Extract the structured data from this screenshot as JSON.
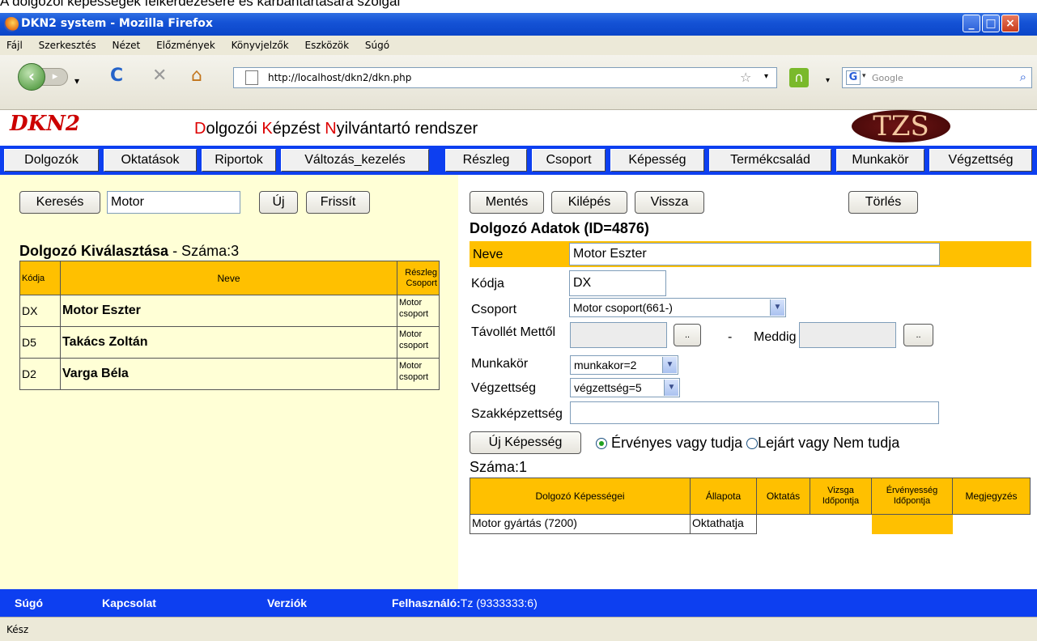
{
  "caption": "A dolgozói képességek felkérdezésére és karbantartására szolgál",
  "window": {
    "title": "DKN2 system - Mozilla Firefox"
  },
  "menu": [
    "Fájl",
    "Szerkesztés",
    "Nézet",
    "Előzmények",
    "Könyvjelzők",
    "Eszközök",
    "Súgó"
  ],
  "browser": {
    "url": "http://localhost/dkn2/dkn.php",
    "search_placeholder": "Google"
  },
  "app": {
    "logo": "DKN2",
    "title_parts": [
      {
        "t": "D",
        "red": true
      },
      {
        "t": "olgozói ",
        "red": false
      },
      {
        "t": "K",
        "red": true
      },
      {
        "t": "épzést ",
        "red": false
      },
      {
        "t": "N",
        "red": true
      },
      {
        "t": "yilvántartó rendszer",
        "red": false
      }
    ],
    "brand_logo": "TZS"
  },
  "tabs_left": [
    "Dolgozók",
    "Oktatások",
    "Riportok",
    "Változás_kezelés"
  ],
  "tabs_right": [
    "Részleg",
    "Csoport",
    "Képesség",
    "Termékcsalád",
    "Munkakör",
    "Végzettség"
  ],
  "left": {
    "search_button": "Keresés",
    "search_value": "Motor",
    "new_button": "Új",
    "refresh_button": "Frissít",
    "list_title": "Dolgozó  Kiválasztása",
    "list_count": " - Száma:3",
    "table_headers": {
      "code": "Kódja",
      "name": "Neve",
      "dept_line1": "Részleg",
      "dept_line2": "Csoport"
    },
    "rows": [
      {
        "code": "DX",
        "name": "Motor Eszter",
        "dept1": "Motor",
        "dept2": "csoport"
      },
      {
        "code": "D5",
        "name": "Takács Zoltán",
        "dept1": "Motor",
        "dept2": "csoport"
      },
      {
        "code": "D2",
        "name": "Varga Béla",
        "dept1": "Motor",
        "dept2": "csoport"
      }
    ]
  },
  "right": {
    "buttons": {
      "save": "Mentés",
      "exit": "Kilépés",
      "back": "Vissza",
      "delete": "Törlés"
    },
    "title": "Dolgozó Adatok (ID=4876)",
    "labels": {
      "name": "Neve",
      "code": "Kódja",
      "group": "Csoport",
      "absence_from": "Távollét Mettől",
      "absence_dash": "-",
      "absence_to": "Meddig",
      "job": "Munkakör",
      "education": "Végzettség",
      "qualification": "Szakképzettség"
    },
    "values": {
      "name": "Motor Eszter",
      "code": "DX",
      "group": "Motor csoport(661-)",
      "job": "munkakor=2",
      "education": "végzettség=5",
      "qualification": "",
      "date_button": ".."
    },
    "new_skill_button": "Új Képesség",
    "radio_valid": "Érvényes vagy tudja",
    "radio_expired": "Lejárt vagy Nem tudja",
    "skill_count": "Száma:1",
    "skill_headers": [
      "Dolgozó  Képességei",
      "Állapota",
      "Oktatás",
      "Vizsga Időpontja",
      "Érvényesség Időpontja",
      "Megjegyzés"
    ],
    "skill_rows": [
      {
        "skill": "Motor gyártás (7200)",
        "status": "Oktathatja",
        "training": "",
        "exam": "",
        "valid": "",
        "note": ""
      }
    ]
  },
  "footer": {
    "help": "Súgó",
    "contact": "Kapcsolat",
    "versions": "Verziók",
    "user_label": "Felhasználó:",
    "user_value": "Tz (9333333:6)"
  },
  "status": "Kész",
  "colors": {
    "accent_blue": "#0d3ff0",
    "header_yellow": "#ffc000",
    "left_bg": "#ffffd6"
  }
}
